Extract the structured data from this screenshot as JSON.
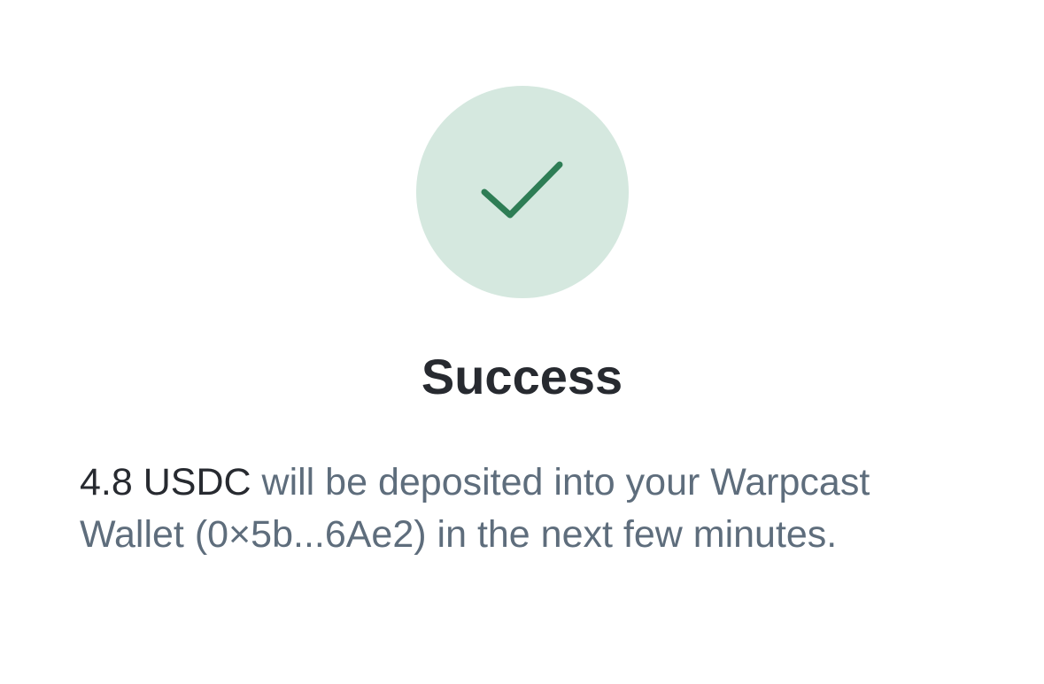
{
  "status": {
    "icon": "checkmark-icon",
    "title": "Success",
    "badge_color": "#d5e8df",
    "check_color": "#2e7d55"
  },
  "message": {
    "amount": "4.8 USDC",
    "line_1_rest": " will be deposited into your Warpcast",
    "line_2": "Wallet (0×5b...6Ae2) in the next few minutes."
  }
}
